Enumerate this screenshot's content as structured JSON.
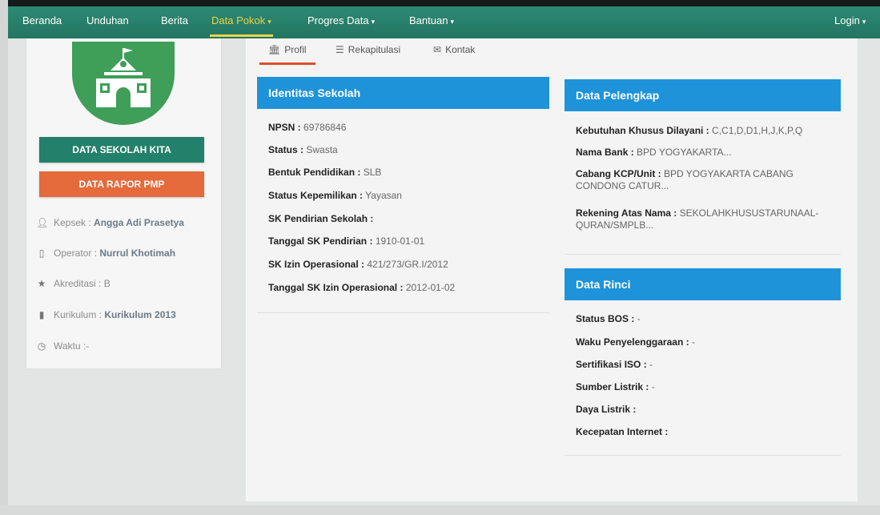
{
  "nav": {
    "items": [
      {
        "label": "Beranda"
      },
      {
        "label": "Unduhan"
      },
      {
        "label": "Berita"
      },
      {
        "label": "Data Pokok"
      },
      {
        "label": "Progres Data"
      },
      {
        "label": "Bantuan"
      }
    ],
    "active_index": 3,
    "login_label": "Login",
    "accent_color": "#ecd24a",
    "background_color": "#2d8b73"
  },
  "sidebar": {
    "buttons": {
      "data_sekolah": "DATA SEKOLAH KITA",
      "data_rapor": "DATA RAPOR PMP"
    },
    "rows": [
      {
        "icon": "user-icon",
        "label": "Kepsek :",
        "value": "Angga Adi Prasetya"
      },
      {
        "icon": "tablet-icon",
        "label": "Operator :",
        "value": "Nurrul Khotimah"
      },
      {
        "icon": "star-icon",
        "label": "Akreditasi :",
        "value": "B"
      },
      {
        "icon": "book-icon",
        "label": "Kurikulum :",
        "value": "Kurikulum 2013"
      },
      {
        "icon": "clock-icon",
        "label": "Waktu :",
        "value": "-"
      }
    ]
  },
  "tabs": [
    {
      "icon": "bank-icon",
      "label": "Profil"
    },
    {
      "icon": "list-icon",
      "label": "Rekapitulasi"
    },
    {
      "icon": "envelope-icon",
      "label": "Kontak"
    }
  ],
  "identitas": {
    "title": "Identitas Sekolah",
    "rows": [
      {
        "label": "NPSN :",
        "value": "69786846"
      },
      {
        "label": "Status :",
        "value": "Swasta"
      },
      {
        "label": "Bentuk Pendidikan :",
        "value": "SLB"
      },
      {
        "label": "Status Kepemilikan :",
        "value": "Yayasan"
      },
      {
        "label": "SK Pendirian Sekolah :",
        "value": ""
      },
      {
        "label": "Tanggal SK Pendirian :",
        "value": "1910-01-01"
      },
      {
        "label": "SK Izin Operasional :",
        "value": "421/273/GR.I/2012"
      },
      {
        "label": "Tanggal SK Izin Operasional :",
        "value": "2012-01-02"
      }
    ]
  },
  "pelengkap": {
    "title": "Data Pelengkap",
    "rows": [
      {
        "label": "Kebutuhan Khusus Dilayani :",
        "value": "C,C1,D,D1,H,J,K,P,Q"
      },
      {
        "label": "Nama Bank :",
        "value": "BPD YOGYAKARTA..."
      },
      {
        "label": "Cabang KCP/Unit :",
        "value": "BPD YOGYAKARTA CABANG CONDONG CATUR..."
      },
      {
        "label": "Rekening Atas Nama :",
        "value": "SEKOLAHKHUSUSTARUNAAL-QURAN/SMPLB..."
      }
    ]
  },
  "rinci": {
    "title": "Data Rinci",
    "rows": [
      {
        "label": "Status BOS :",
        "value": "-"
      },
      {
        "label": "Waku Penyelenggaraan :",
        "value": "-"
      },
      {
        "label": "Sertifikasi ISO :",
        "value": "-"
      },
      {
        "label": "Sumber Listrik :",
        "value": "-"
      },
      {
        "label": "Daya Listrik :",
        "value": ""
      },
      {
        "label": "Kecepatan Internet :",
        "value": ""
      }
    ]
  },
  "colors": {
    "panel_header": "#1f93d9",
    "button_green": "#23806a",
    "button_orange": "#e56a3c",
    "tab_underline": "#e04b2c"
  }
}
